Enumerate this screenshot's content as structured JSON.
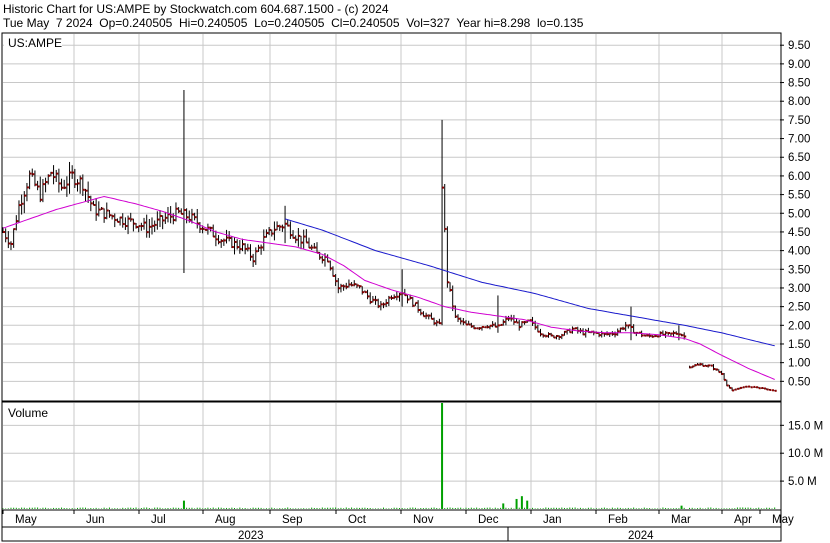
{
  "header": {
    "line1": "Historic Chart for US:AMPE by Stockwatch.com 604.687.1500 - (c) 2024",
    "line2": "Tue May  7 2024  Op=0.240505  Hi=0.240505  Lo=0.240505  Cl=0.240505  Vol=327  Year hi=8.298  lo=0.135"
  },
  "price_panel": {
    "label": "US:AMPE"
  },
  "volume_panel": {
    "label": "Volume"
  },
  "colors": {
    "candle": "#8b0000",
    "wick": "#000000",
    "ma_short": "#d000d0",
    "ma_long": "#1a1acc",
    "volume": "#00a000",
    "grid": "#c8c8c8"
  },
  "chart_data": [
    {
      "type": "candlestick",
      "title": "US:AMPE",
      "ylim": [
        0,
        9.8
      ],
      "yticks": [
        "0.50",
        "1.00",
        "1.50",
        "2.00",
        "2.50",
        "3.00",
        "3.50",
        "4.00",
        "4.50",
        "5.00",
        "5.50",
        "6.00",
        "6.50",
        "7.00",
        "7.50",
        "8.00",
        "8.50",
        "9.00",
        "9.50"
      ],
      "ytick_values": [
        0.5,
        1.0,
        1.5,
        2.0,
        2.5,
        3.0,
        3.5,
        4.0,
        4.5,
        5.0,
        5.5,
        6.0,
        6.5,
        7.0,
        7.5,
        8.0,
        8.5,
        9.0,
        9.5
      ],
      "x_months": [
        "May",
        "Jun",
        "Jul",
        "Aug",
        "Sep",
        "Oct",
        "Nov",
        "Dec",
        "Jan",
        "Feb",
        "Mar",
        "Apr",
        "May"
      ],
      "x_years": [
        "2023",
        "2024"
      ],
      "grid": true,
      "close_anchors": [
        [
          0,
          4.5
        ],
        [
          3,
          4.2
        ],
        [
          6,
          5.2
        ],
        [
          10,
          6.0
        ],
        [
          14,
          5.5
        ],
        [
          18,
          6.1
        ],
        [
          22,
          5.7
        ],
        [
          26,
          6.0
        ],
        [
          30,
          5.8
        ],
        [
          34,
          5.1
        ],
        [
          38,
          5.0
        ],
        [
          42,
          4.9
        ],
        [
          46,
          4.8
        ],
        [
          50,
          4.75
        ],
        [
          54,
          4.6
        ],
        [
          58,
          4.75
        ],
        [
          62,
          4.9
        ],
        [
          66,
          5.0
        ],
        [
          70,
          4.9
        ],
        [
          74,
          4.7
        ],
        [
          78,
          4.5
        ],
        [
          82,
          4.3
        ],
        [
          86,
          4.2
        ],
        [
          90,
          4.1
        ],
        [
          94,
          3.8
        ],
        [
          98,
          4.3
        ],
        [
          102,
          4.6
        ],
        [
          106,
          4.7
        ],
        [
          110,
          4.4
        ],
        [
          114,
          4.2
        ],
        [
          118,
          3.9
        ],
        [
          122,
          3.8
        ],
        [
          126,
          3.0
        ],
        [
          130,
          3.1
        ],
        [
          134,
          3.0
        ],
        [
          138,
          2.7
        ],
        [
          142,
          2.5
        ],
        [
          146,
          2.8
        ],
        [
          150,
          2.9
        ],
        [
          154,
          2.6
        ],
        [
          158,
          2.3
        ],
        [
          162,
          2.1
        ],
        [
          164,
          2.0
        ],
        [
          165,
          5.8
        ],
        [
          167,
          3.2
        ],
        [
          170,
          2.2
        ],
        [
          174,
          2.0
        ],
        [
          178,
          1.95
        ],
        [
          182,
          2.0
        ],
        [
          186,
          1.95
        ],
        [
          190,
          2.2
        ],
        [
          194,
          2.0
        ],
        [
          198,
          2.1
        ],
        [
          202,
          1.8
        ],
        [
          206,
          1.7
        ],
        [
          210,
          1.75
        ],
        [
          214,
          1.9
        ],
        [
          218,
          1.8
        ],
        [
          222,
          1.8
        ],
        [
          226,
          1.75
        ],
        [
          230,
          1.8
        ],
        [
          234,
          2.0
        ],
        [
          238,
          1.8
        ],
        [
          242,
          1.7
        ],
        [
          246,
          1.75
        ],
        [
          250,
          1.75
        ],
        [
          254,
          1.8
        ],
        [
          256,
          1.7
        ],
        [
          258,
          0.9
        ],
        [
          262,
          0.95
        ],
        [
          266,
          0.9
        ],
        [
          270,
          0.7
        ],
        [
          272,
          0.4
        ],
        [
          274,
          0.25
        ],
        [
          278,
          0.35
        ],
        [
          282,
          0.35
        ],
        [
          286,
          0.3
        ],
        [
          290,
          0.24
        ]
      ],
      "spikes": [
        {
          "day": 68,
          "high": 8.3,
          "low": 3.4
        },
        {
          "day": 106,
          "high": 5.2,
          "low": 4.2
        },
        {
          "day": 150,
          "high": 3.5,
          "low": 2.5
        },
        {
          "day": 165,
          "high": 7.5,
          "low": 2.0
        },
        {
          "day": 186,
          "high": 2.8,
          "low": 1.8
        },
        {
          "day": 236,
          "high": 2.5,
          "low": 1.6
        },
        {
          "day": 254,
          "high": 2.0,
          "low": 1.6
        }
      ],
      "series": [
        {
          "values_anchors": [
            [
              0,
              4.6
            ],
            [
              20,
              5.1
            ],
            [
              38,
              5.45
            ],
            [
              50,
              5.25
            ],
            [
              60,
              5.05
            ],
            [
              70,
              4.8
            ],
            [
              80,
              4.5
            ],
            [
              90,
              4.3
            ],
            [
              100,
              4.2
            ],
            [
              110,
              4.1
            ],
            [
              120,
              3.9
            ],
            [
              128,
              3.6
            ],
            [
              136,
              3.2
            ],
            [
              146,
              2.95
            ],
            [
              156,
              2.75
            ],
            [
              166,
              2.5
            ],
            [
              176,
              2.35
            ],
            [
              186,
              2.25
            ],
            [
              196,
              2.15
            ],
            [
              206,
              1.95
            ],
            [
              216,
              1.85
            ],
            [
              226,
              1.8
            ],
            [
              236,
              1.8
            ],
            [
              246,
              1.75
            ],
            [
              256,
              1.65
            ],
            [
              262,
              1.5
            ],
            [
              270,
              1.2
            ],
            [
              280,
              0.85
            ],
            [
              290,
              0.55
            ]
          ]
        },
        {
          "values_anchors": [
            [
              106,
              4.85
            ],
            [
              120,
              4.55
            ],
            [
              140,
              4.0
            ],
            [
              160,
              3.6
            ],
            [
              180,
              3.15
            ],
            [
              200,
              2.85
            ],
            [
              220,
              2.45
            ],
            [
              240,
              2.2
            ],
            [
              256,
              2.0
            ],
            [
              270,
              1.8
            ],
            [
              290,
              1.45
            ]
          ]
        }
      ]
    },
    {
      "type": "bar",
      "title": "Volume",
      "ylim": [
        0,
        19
      ],
      "yticks": [
        "5.0 M",
        "10.0 M",
        "15.0 M"
      ],
      "ytick_values": [
        5,
        10,
        15
      ],
      "spikes": [
        {
          "day": 68,
          "value": 1.5
        },
        {
          "day": 165,
          "value": 19
        },
        {
          "day": 188,
          "value": 1.0
        },
        {
          "day": 193,
          "value": 1.8
        },
        {
          "day": 195,
          "value": 2.3
        },
        {
          "day": 197,
          "value": 1.5
        },
        {
          "day": 255,
          "value": 0.6
        }
      ]
    }
  ]
}
